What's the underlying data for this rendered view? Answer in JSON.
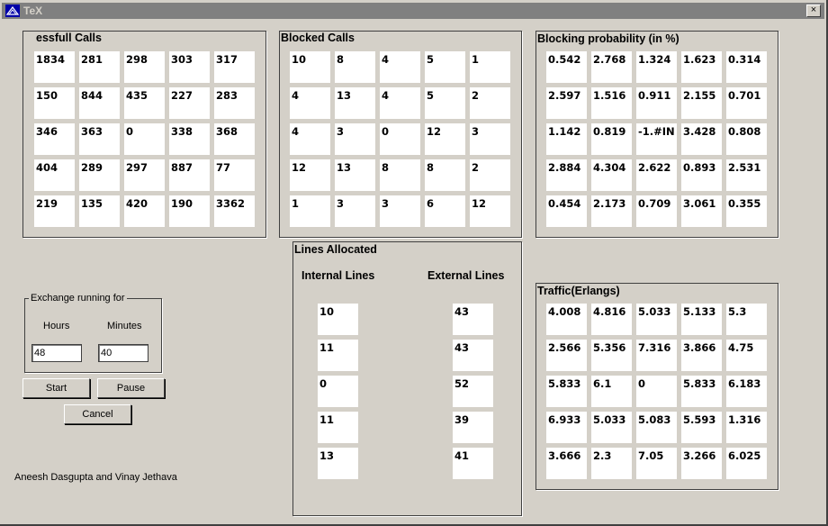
{
  "window": {
    "title": "TeX",
    "close_glyph": "×"
  },
  "successful_calls": {
    "title": "essfull Calls",
    "rows": [
      [
        "1834",
        "281",
        "298",
        "303",
        "317"
      ],
      [
        "150",
        "844",
        "435",
        "227",
        "283"
      ],
      [
        "346",
        "363",
        "0",
        "338",
        "368"
      ],
      [
        "404",
        "289",
        "297",
        "887",
        "77"
      ],
      [
        "219",
        "135",
        "420",
        "190",
        "3362"
      ]
    ]
  },
  "blocked_calls": {
    "title": "Blocked Calls",
    "rows": [
      [
        "10",
        "8",
        "4",
        "5",
        "1"
      ],
      [
        "4",
        "13",
        "4",
        "5",
        "2"
      ],
      [
        "4",
        "3",
        "0",
        "12",
        "3"
      ],
      [
        "12",
        "13",
        "8",
        "8",
        "2"
      ],
      [
        "1",
        "3",
        "3",
        "6",
        "12"
      ]
    ]
  },
  "blocking_probability": {
    "title": "Blocking probability (in %)",
    "rows": [
      [
        "0.542",
        "2.768",
        "1.324",
        "1.623",
        "0.314"
      ],
      [
        "2.597",
        "1.516",
        "0.911",
        "2.155",
        "0.701"
      ],
      [
        "1.142",
        "0.819",
        "-1.#IN",
        "3.428",
        "0.808"
      ],
      [
        "2.884",
        "4.304",
        "2.622",
        "0.893",
        "2.531"
      ],
      [
        "0.454",
        "2.173",
        "0.709",
        "3.061",
        "0.355"
      ]
    ]
  },
  "lines_allocated": {
    "title": "Lines Allocated",
    "internal_label": "Internal Lines",
    "external_label": "External Lines",
    "internal": [
      "10",
      "11",
      "0",
      "11",
      "13"
    ],
    "external": [
      "43",
      "43",
      "52",
      "39",
      "41"
    ]
  },
  "traffic": {
    "title": "Traffic(Erlangs)",
    "rows": [
      [
        "4.008",
        "4.816",
        "5.033",
        "5.133",
        "5.3"
      ],
      [
        "2.566",
        "5.356",
        "7.316",
        "3.866",
        "4.75"
      ],
      [
        "5.833",
        "6.1",
        "0",
        "5.833",
        "6.183"
      ],
      [
        "6.933",
        "5.033",
        "5.083",
        "5.593",
        "1.316"
      ],
      [
        "3.666",
        "2.3",
        "7.05",
        "3.266",
        "6.025"
      ]
    ]
  },
  "exchange": {
    "title": "Exchange running for",
    "hours_label": "Hours",
    "minutes_label": "Minutes",
    "hours_value": "48",
    "minutes_value": "40"
  },
  "buttons": {
    "start": "Start",
    "pause": "Pause",
    "cancel": "Cancel"
  },
  "credits": "Aneesh Dasgupta and Vinay Jethava"
}
